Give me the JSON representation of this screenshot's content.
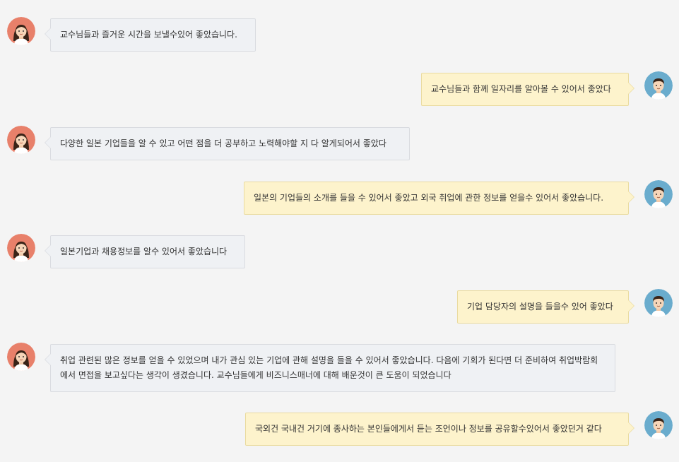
{
  "avatars": {
    "student_icon": "female-student-avatar-icon",
    "student_bg": "#e8806a",
    "staff_icon": "male-staff-avatar-icon",
    "staff_bg": "#6aaccd"
  },
  "messages": [
    {
      "side": "left",
      "text": "교수님들과 즐거운 시간을 보낼수있어 좋았습니다."
    },
    {
      "side": "right",
      "text": "교수님들과 함께 일자리를 알아볼 수 있어서 좋았다"
    },
    {
      "side": "left",
      "text": "다양한 일본 기업들을 알 수 있고 어떤 점을 더 공부하고 노력해야할 지 다 알게되어서 좋았다"
    },
    {
      "side": "right",
      "text": "일본의 기업들의 소개를 들을 수 있어서 좋았고 외국 취업에 관한 정보를 얻을수 있어서 좋았습니다."
    },
    {
      "side": "left",
      "text": "일본기업과 채용정보를 알수 있어서 좋았습니다"
    },
    {
      "side": "right",
      "text": "기업 담당자의 설명을 들을수 있어 좋았다"
    },
    {
      "side": "left",
      "text": "취업 관련된 많은 정보를 얻을 수 있었으며 내가 관심 있는 기업에 관해 설명을 들을 수 있어서 좋았습니다. 다음에 기회가 된다면 더 준비하여 취업박람회에서 면접을 보고싶다는 생각이 생겼습니다. 교수님들에게 비즈니스매너에 대해 배운것이 큰 도움이 되었습니다"
    },
    {
      "side": "right",
      "text": "국외건 국내건 거기에 종사하는 본인들에게서 듣는 조언이나 정보를 공유할수있어서 좋았던거 같다"
    }
  ]
}
